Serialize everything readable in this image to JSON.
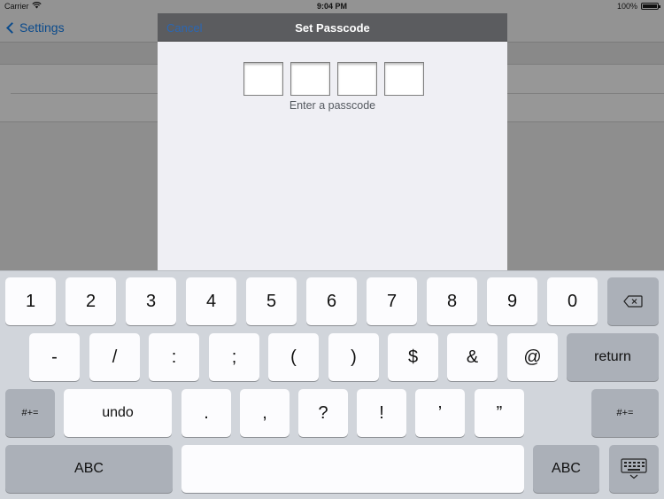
{
  "status_bar": {
    "carrier": "Carrier",
    "time": "9:04 PM",
    "battery_text": "100%",
    "battery_level": 1.0
  },
  "background": {
    "back_label": "Settings"
  },
  "modal": {
    "cancel_label": "Cancel",
    "title": "Set Passcode",
    "prompt": "Enter a passcode",
    "digit_boxes": 4
  },
  "keyboard": {
    "row1": [
      "1",
      "2",
      "3",
      "4",
      "5",
      "6",
      "7",
      "8",
      "9",
      "0"
    ],
    "row2": [
      "-",
      "/",
      ":",
      ";",
      "(",
      ")",
      "$",
      "&",
      "@"
    ],
    "return_label": "return",
    "row3_mid": [
      ".",
      ",",
      "?",
      "!",
      "’",
      "”"
    ],
    "more_symbols_label": "#+=",
    "undo_label": "undo",
    "abc_label": "ABC",
    "space_label": ""
  },
  "colors": {
    "accent": "#2b67b3",
    "keyboard_bg": "#d1d5db",
    "key_light": "#fcfcfe",
    "key_dark": "#abb0b8"
  }
}
